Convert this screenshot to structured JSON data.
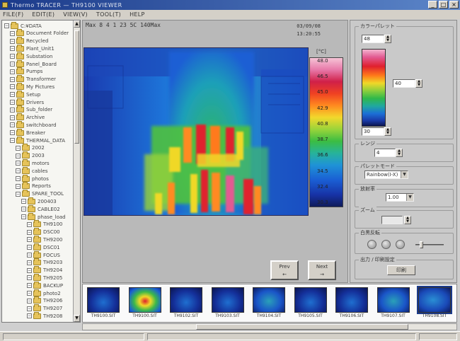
{
  "window": {
    "title": "Thermo TRACER — TH9100 VIEWER"
  },
  "menu": [
    {
      "label": "FILE(F)"
    },
    {
      "label": "EDIT(E)"
    },
    {
      "label": "VIEW(V)"
    },
    {
      "label": "TOOL(T)"
    },
    {
      "label": "HELP"
    }
  ],
  "tree": {
    "items": [
      {
        "label": "C:¥DATA",
        "expanded": true
      },
      {
        "label": "Document Folder",
        "expanded": true
      },
      {
        "label": "Recycled",
        "expanded": true
      },
      {
        "label": "Plant_Unit1",
        "expanded": true
      },
      {
        "label": "Substation",
        "expanded": true
      },
      {
        "label": "Panel_Board",
        "expanded": true
      },
      {
        "label": "Pumps",
        "expanded": true
      },
      {
        "label": "Transformer",
        "expanded": true
      },
      {
        "label": "My Pictures",
        "expanded": true
      },
      {
        "label": "Setup",
        "expanded": true
      },
      {
        "label": "Drivers",
        "expanded": true
      },
      {
        "label": "Sub_folder",
        "expanded": true
      },
      {
        "label": "Archive",
        "expanded": true
      },
      {
        "label": "switchboard",
        "expanded": true
      },
      {
        "label": "Breaker",
        "expanded": true
      },
      {
        "label": "THERMAL_DATA",
        "expanded": true
      },
      {
        "label": "2002",
        "expanded": true
      },
      {
        "label": "2003",
        "expanded": true
      },
      {
        "label": "motors",
        "expanded": true
      },
      {
        "label": "cables",
        "expanded": true
      },
      {
        "label": "photos",
        "expanded": true
      },
      {
        "label": "Reports",
        "expanded": true
      },
      {
        "label": "SPARE_TOOL",
        "expanded": true
      },
      {
        "label": "200403",
        "expanded": true
      },
      {
        "label": "CABLE02",
        "expanded": true
      },
      {
        "label": "phase_load",
        "expanded": true
      },
      {
        "label": "TH9100",
        "expanded": true
      },
      {
        "label": "DSC00",
        "expanded": true
      },
      {
        "label": "TH9200",
        "expanded": true
      },
      {
        "label": "DSC01",
        "expanded": true
      },
      {
        "label": "FOCUS",
        "expanded": true
      },
      {
        "label": "TH9203",
        "expanded": true
      },
      {
        "label": "TH9204",
        "expanded": true
      },
      {
        "label": "TH9205",
        "expanded": true
      },
      {
        "label": "BACKUP",
        "expanded": true
      },
      {
        "label": "photo2",
        "expanded": true
      },
      {
        "label": "TH9206",
        "expanded": true
      },
      {
        "label": "TH9207",
        "expanded": true
      },
      {
        "label": "TH9208",
        "expanded": true
      }
    ]
  },
  "viewer": {
    "header": "Max  8  4  1  23  5C  140Max",
    "date": "03/09/08",
    "time": "13:20:55",
    "scale_unit": "[°C]",
    "scale_ticks": [
      "48.0",
      "46.5",
      "45.0",
      "42.9",
      "40.8",
      "38.7",
      "36.6",
      "34.5",
      "32.4",
      "30.3"
    ],
    "prev_label": "Prev",
    "next_label": "Next",
    "prev_arrow": "←",
    "next_arrow": "→"
  },
  "panel": {
    "color_label": "カラーパレット",
    "max_value": "48",
    "mid_value": "40",
    "min_value": "30",
    "range_label": "レンジ",
    "range_value": "4",
    "mode_label": "パレットモード",
    "mode_value": "Rainbow(I-X)",
    "emissivity_label": "放射率",
    "emissivity_value": "1.00",
    "zoom_label": "ズーム",
    "zoom_value": "",
    "balance_label": "白黒反転",
    "output_label": "出力 / 印刷設定",
    "output_button": "印刷"
  },
  "thumbnails": [
    {
      "caption": "TH9100.SIT",
      "palette": "dark"
    },
    {
      "caption": "TH9100.SIT",
      "palette": "hot"
    },
    {
      "caption": "TH9102.SIT",
      "palette": "dark"
    },
    {
      "caption": "TH9103.SIT",
      "palette": "dark"
    },
    {
      "caption": "TH9104.SIT",
      "palette": "mid"
    },
    {
      "caption": "TH9105.SIT",
      "palette": "dark"
    },
    {
      "caption": "TH9106.SIT",
      "palette": "dark"
    },
    {
      "caption": "TH9107.SIT",
      "palette": "mid"
    },
    {
      "caption": "TH9108.SIT",
      "palette": "selected"
    }
  ],
  "colors": {
    "titlebar": "#1b3a8a",
    "panel_bg": "#c9c9c9",
    "thermal_cold": "#1a3fb5",
    "thermal_hot": "#f04222"
  }
}
